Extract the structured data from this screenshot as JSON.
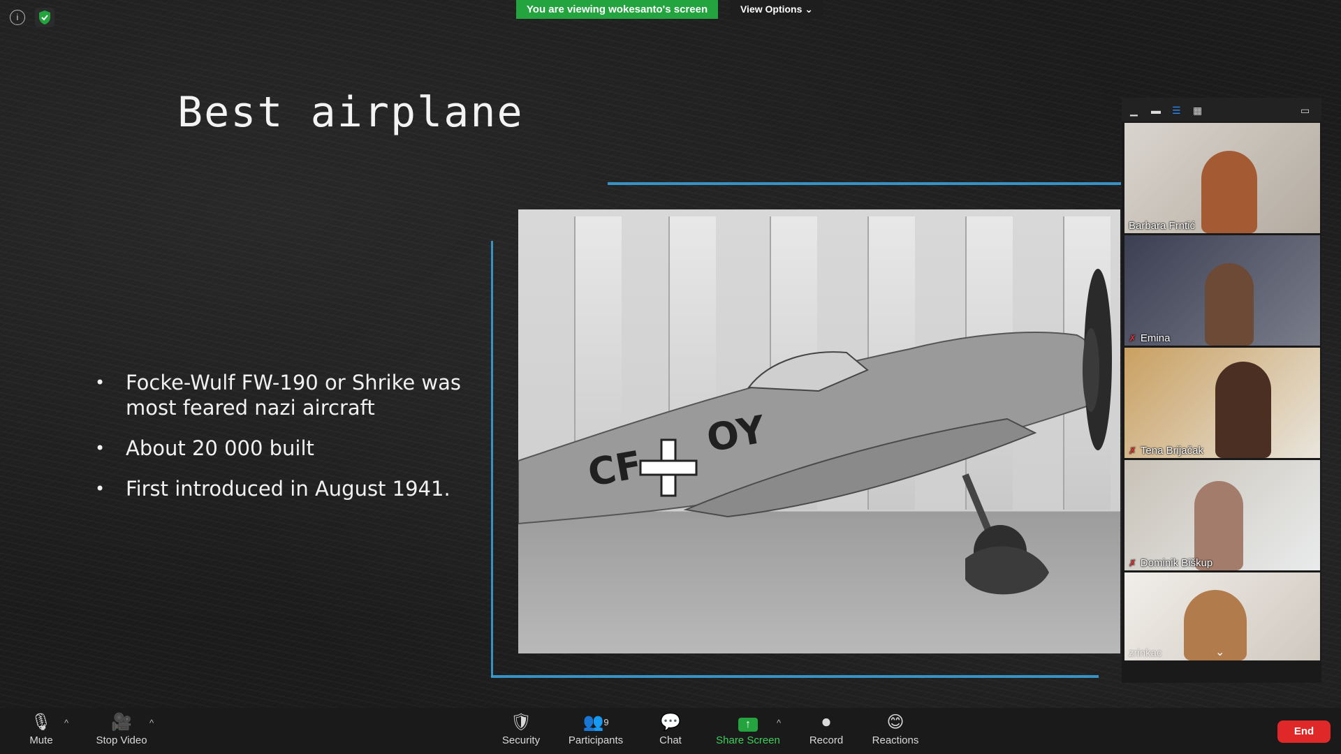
{
  "banner": {
    "viewing_text": "You are viewing wokesanto's screen",
    "view_options": "View Options ⌄"
  },
  "slide": {
    "title": "Best airplane",
    "bullets": [
      "Focke-Wulf FW-190 or Shrike was most feared nazi aircraft",
      "About 20 000 built",
      "First introduced in August 1941."
    ],
    "photo_markings": {
      "left": "CF",
      "right": "OY"
    }
  },
  "gallery": {
    "participants": [
      {
        "name": "Barbara Frntić",
        "muted": false
      },
      {
        "name": "Emina",
        "muted": true
      },
      {
        "name": "Tena Brijačak",
        "muted": true
      },
      {
        "name": "Dominik Biškup",
        "muted": true
      },
      {
        "name": "zrinkac",
        "muted": false
      }
    ]
  },
  "toolbar": {
    "mute": "Mute",
    "stop_video": "Stop Video",
    "security": "Security",
    "participants": "Participants",
    "participants_count": "9",
    "chat": "Chat",
    "share_screen": "Share Screen",
    "record": "Record",
    "reactions": "Reactions",
    "end": "End"
  },
  "colors": {
    "share_green": "#23a43e",
    "end_red": "#e02828",
    "slide_accent": "#3aa0d8"
  }
}
